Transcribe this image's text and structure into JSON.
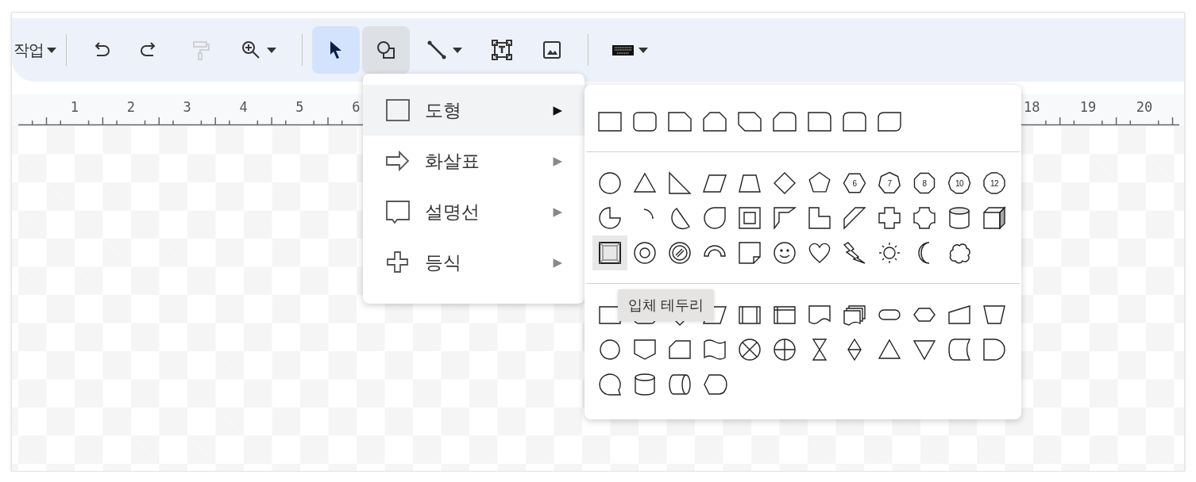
{
  "toolbar": {
    "items": [
      {
        "kind": "menu",
        "label": "작업"
      },
      {
        "kind": "divider"
      },
      {
        "kind": "undo",
        "dropdown": false,
        "disabled": false,
        "selected": false,
        "open": false
      },
      {
        "kind": "redo",
        "dropdown": false,
        "disabled": false,
        "selected": false,
        "open": false
      },
      {
        "kind": "paint",
        "dropdown": false,
        "disabled": true,
        "selected": false,
        "open": false
      },
      {
        "kind": "zoom",
        "dropdown": true,
        "disabled": false,
        "selected": false,
        "open": false
      },
      {
        "kind": "divider"
      },
      {
        "kind": "select",
        "dropdown": false,
        "disabled": false,
        "selected": true,
        "open": false
      },
      {
        "kind": "shape",
        "dropdown": false,
        "disabled": false,
        "selected": false,
        "open": true
      },
      {
        "kind": "line",
        "dropdown": true,
        "disabled": false,
        "selected": false,
        "open": false
      },
      {
        "kind": "textbox",
        "dropdown": false,
        "disabled": false,
        "selected": false,
        "open": false
      },
      {
        "kind": "image",
        "dropdown": false,
        "disabled": false,
        "selected": false,
        "open": false
      },
      {
        "kind": "divider"
      },
      {
        "kind": "keyboard",
        "dropdown": true,
        "disabled": false,
        "selected": false,
        "open": false
      }
    ]
  },
  "ruler": {
    "left_labels": [
      "1",
      "2",
      "3",
      "4",
      "5",
      "6"
    ],
    "right_labels": [
      "18",
      "19",
      "20"
    ]
  },
  "insert_menu": {
    "items": [
      {
        "label": "도형",
        "arrow": "▶",
        "highlighted": true
      },
      {
        "label": "화살표",
        "arrow": "▶",
        "highlighted": false
      },
      {
        "label": "설명선",
        "arrow": "▶",
        "highlighted": false
      },
      {
        "label": "등식",
        "arrow": "▶",
        "highlighted": false
      }
    ]
  },
  "shape_palette": {
    "sections": [
      {
        "shapes": [
          {
            "hovered": false
          },
          {
            "hovered": false
          },
          {
            "hovered": false
          },
          {
            "hovered": false
          },
          {
            "hovered": false
          },
          {
            "hovered": false
          },
          {
            "hovered": false
          },
          {
            "hovered": false
          },
          {
            "hovered": false
          }
        ]
      },
      {
        "shapes": [
          {
            "hovered": false
          },
          {
            "hovered": false
          },
          {
            "hovered": false
          },
          {
            "hovered": false
          },
          {
            "hovered": false
          },
          {
            "hovered": false
          },
          {
            "hovered": false
          },
          {
            "hovered": false,
            "label": "6"
          },
          {
            "hovered": false,
            "label": "7"
          },
          {
            "hovered": false,
            "label": "8"
          },
          {
            "hovered": false,
            "label": "10"
          },
          {
            "hovered": false,
            "label": "12"
          },
          {
            "hovered": false
          },
          {
            "hovered": false
          },
          {
            "hovered": false
          },
          {
            "hovered": false
          },
          {
            "hovered": false
          },
          {
            "hovered": false
          },
          {
            "hovered": false
          },
          {
            "hovered": false
          },
          {
            "hovered": false
          },
          {
            "hovered": false
          },
          {
            "hovered": false
          },
          {
            "hovered": false
          },
          {
            "hovered": true
          },
          {
            "hovered": false
          },
          {
            "hovered": false
          },
          {
            "hovered": false
          },
          {
            "hovered": false
          },
          {
            "hovered": false
          },
          {
            "hovered": false
          },
          {
            "hovered": false
          },
          {
            "hovered": false
          },
          {
            "hovered": false
          },
          {
            "hovered": false
          }
        ]
      },
      {
        "shapes": [
          {
            "hovered": false
          },
          {
            "hovered": false
          },
          {
            "hovered": false
          },
          {
            "hovered": false
          },
          {
            "hovered": false
          },
          {
            "hovered": false
          },
          {
            "hovered": false
          },
          {
            "hovered": false
          },
          {
            "hovered": false
          },
          {
            "hovered": false
          },
          {
            "hovered": false
          },
          {
            "hovered": false
          },
          {
            "hovered": false
          },
          {
            "hovered": false
          },
          {
            "hovered": false
          },
          {
            "hovered": false
          },
          {
            "hovered": false
          },
          {
            "hovered": false
          },
          {
            "hovered": false
          },
          {
            "hovered": false
          },
          {
            "hovered": false
          },
          {
            "hovered": false
          },
          {
            "hovered": false
          },
          {
            "hovered": false
          },
          {
            "hovered": false
          },
          {
            "hovered": false
          },
          {
            "hovered": false
          },
          {
            "hovered": false
          }
        ]
      }
    ]
  },
  "tooltip": {
    "text": "입체 테두리"
  }
}
